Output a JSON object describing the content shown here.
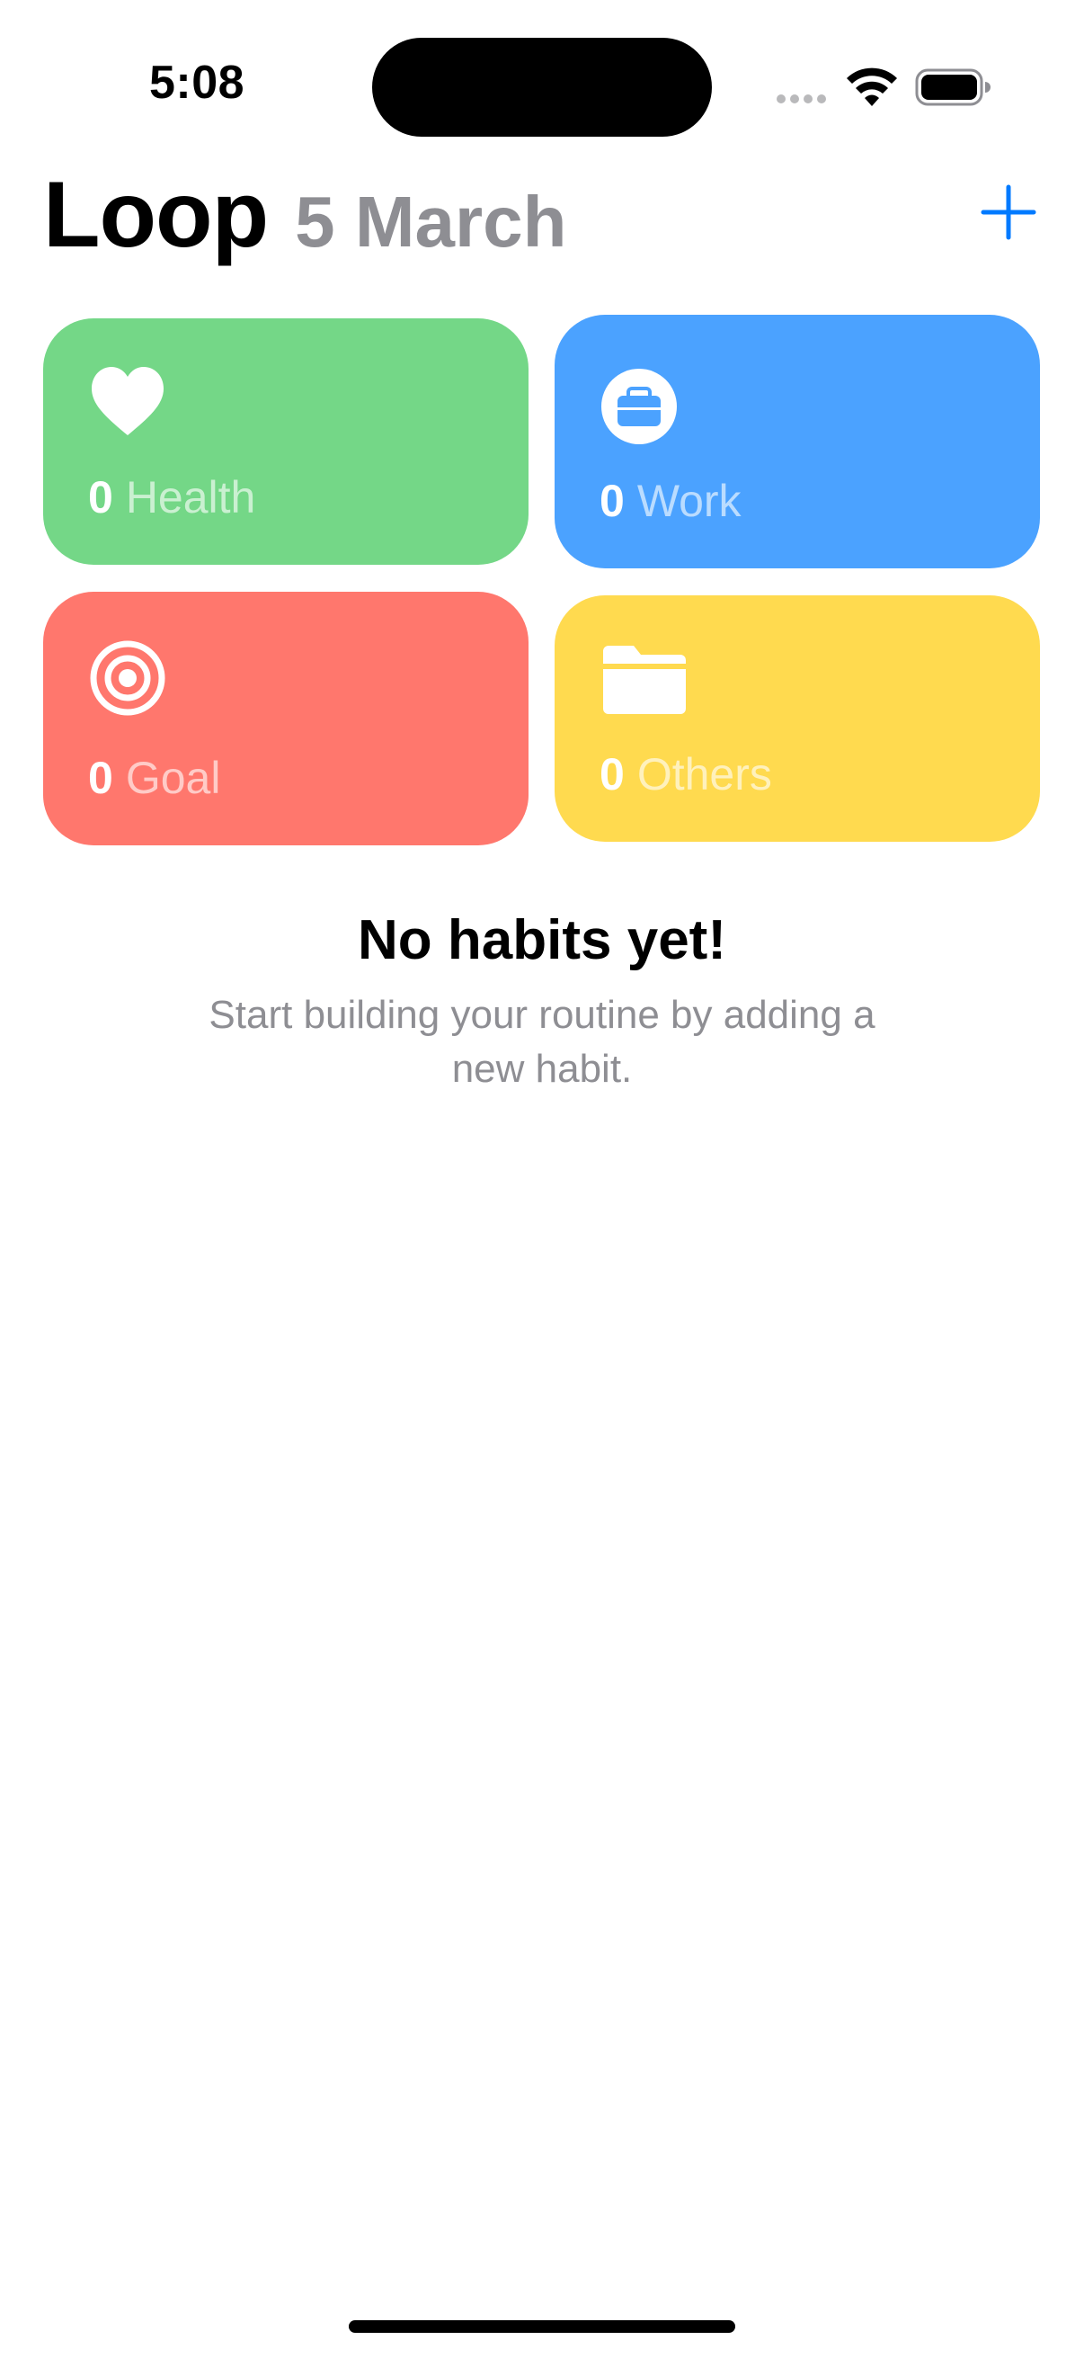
{
  "status_bar": {
    "time": "5:08",
    "icons": [
      "signal-dots-icon",
      "wifi-icon",
      "battery-icon"
    ]
  },
  "header": {
    "title": "Loop",
    "date": "5 March",
    "add_icon": "plus-icon"
  },
  "categories": [
    {
      "icon": "heart-icon",
      "count": "0",
      "label": "Health",
      "color": "#74d787"
    },
    {
      "icon": "briefcase-icon",
      "count": "0",
      "label": "Work",
      "color": "#4ba2ff"
    },
    {
      "icon": "target-icon",
      "count": "0",
      "label": "Goal",
      "color": "#ff776d"
    },
    {
      "icon": "folder-icon",
      "count": "0",
      "label": "Others",
      "color": "#ffda4f"
    }
  ],
  "empty_state": {
    "title": "No habits yet!",
    "subtitle": "Start building your routine by adding a new habit."
  },
  "colors": {
    "accent": "#007aff",
    "secondary_text": "#8e8e93"
  }
}
